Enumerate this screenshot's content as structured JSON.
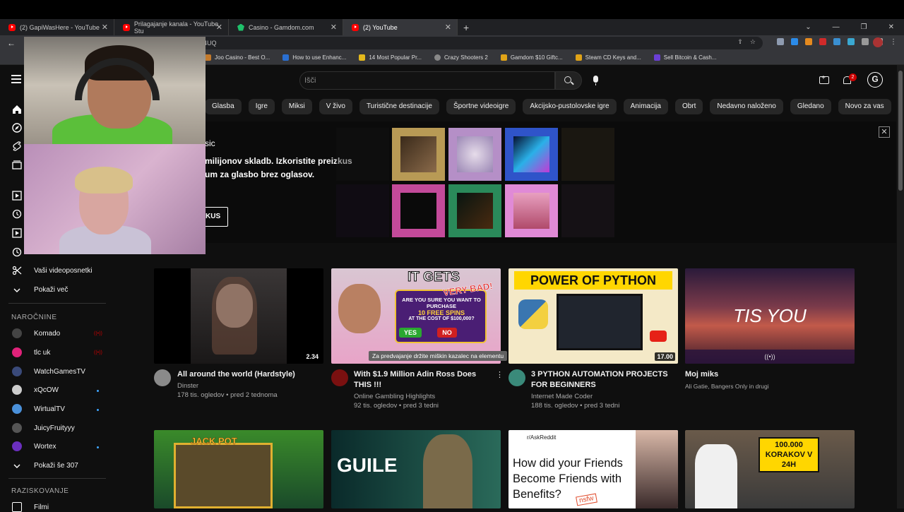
{
  "browser": {
    "tabs": [
      {
        "title": "(2) GapiWasHere - YouTube",
        "active": false
      },
      {
        "title": "Prilagajanje kanala - YouTube Stu",
        "active": false
      },
      {
        "title": "Casino - Gamdom.com",
        "active": false
      },
      {
        "title": "(2) YouTube",
        "active": true
      }
    ],
    "new_tab": "+",
    "window_controls": [
      "⌄",
      "—",
      "❐",
      "✕"
    ],
    "url_fragment": "4UQ",
    "bookmarks": [
      {
        "label": "Joo Casino - Best O...",
        "color": "#c47a2b"
      },
      {
        "label": "How to use Enhanc...",
        "color": "#2a6fd1"
      },
      {
        "label": "14 Most Popular Pr...",
        "color": "#e3b81c"
      },
      {
        "label": "Crazy Shooters 2",
        "color": "#888888"
      },
      {
        "label": "Gamdom $10 Giftc...",
        "color": "#e0a317"
      },
      {
        "label": "Steam CD Keys and...",
        "color": "#e0a317"
      },
      {
        "label": "Sell Bitcoin & Cash...",
        "color": "#6b3fd6"
      }
    ]
  },
  "youtube": {
    "search_placeholder": "Išči",
    "notification_count": "2",
    "user_initial": "G",
    "chips": [
      "Glasba",
      "Igre",
      "Miksi",
      "V živo",
      "Turistične destinacije",
      "Športne videoigre",
      "Akcijsko-pustolovske igre",
      "Animacija",
      "Obrt",
      "Nedavno naloženo",
      "Gledano",
      "Novo za vas"
    ],
    "banner": {
      "title_fragment": "sic",
      "text_fragment": "milijonov skladb. Izkoristite preizkus um za glasbo brez oglasov.",
      "button_fragment": "KUS",
      "close": "✕"
    },
    "sidebar": {
      "items": [
        {
          "label": "Vaši videoposnetki"
        },
        {
          "label": "Pokaži več"
        }
      ],
      "subscriptions_header": "NAROČNINE",
      "subscriptions": [
        {
          "name": "Komado",
          "indicator": "live",
          "color": "#444444"
        },
        {
          "name": "tlc uk",
          "indicator": "live",
          "color": "#e0227a"
        },
        {
          "name": "WatchGamesTV",
          "indicator": "",
          "color": "#3a4a7a"
        },
        {
          "name": "xQcOW",
          "indicator": "dot",
          "color": "#cccccc"
        },
        {
          "name": "WirtualTV",
          "indicator": "dot",
          "color": "#4a90d9"
        },
        {
          "name": "JuicyFruityyy",
          "indicator": "",
          "color": "#555555"
        },
        {
          "name": "Wortex",
          "indicator": "dot",
          "color": "#6b2fbf"
        }
      ],
      "show_more_subs": "Pokaži še 307",
      "explore_header": "RAZISKOVANJE",
      "explore_item": "Filmi"
    },
    "videos": [
      {
        "title": "All around the world (Hardstyle)",
        "channel": "Dinster",
        "meta": "178 tis. ogledov • pred 2 tednoma",
        "duration": "2.34"
      },
      {
        "title": "With $1.9 Million Adin Ross Does THIS !!!",
        "channel": "Online Gambling Highlights",
        "meta": "92 tis. ogledov • pred 3 tedni",
        "duration": "",
        "overlay_big": "IT GETS",
        "overlay_red": "VERY BAD!",
        "overlay_q": "ARE YOU SURE YOU WANT TO PURCHASE",
        "overlay_spins": "10 FREE SPINS",
        "overlay_cost": "AT THE COST OF $100,000?",
        "overlay_yes": "YES",
        "overlay_no": "NO"
      },
      {
        "title": "3 PYTHON AUTOMATION PROJECTS FOR BEGINNERS",
        "channel": "Internet Made Coder",
        "meta": "188 tis. ogledov • pred 3 tedni",
        "duration": "17.00",
        "thumb_text": "POWER OF PYTHON"
      },
      {
        "title": "Moj miks",
        "channel": "Ali Gatie, Bangers Only in drugi",
        "meta": "",
        "duration": "",
        "thumb_text": "TIS YOU"
      }
    ],
    "tooltip": "Za predvajanje držite miškin kazalec na elementu",
    "row2": [
      {
        "thumb_text": "JACK POT"
      },
      {
        "thumb_text": "GUILE"
      },
      {
        "thumb_text": "How did your Friends Become Friends with Benefits?",
        "badge": "nsfw",
        "sub": "r/AskReddit"
      },
      {
        "thumb_text": "100.000 KORAKOV V 24H"
      }
    ]
  }
}
